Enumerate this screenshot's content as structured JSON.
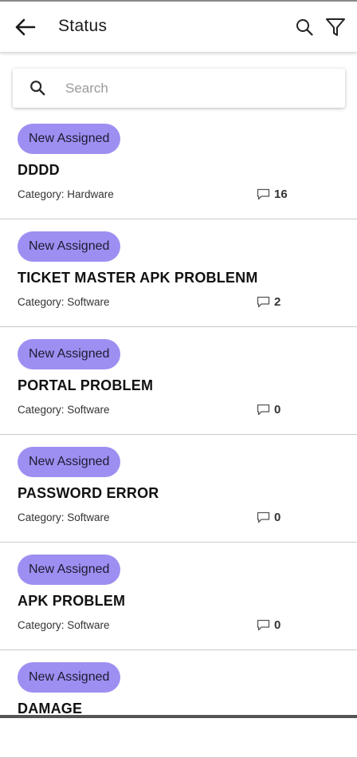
{
  "appbar": {
    "title": "Status",
    "back_icon": "arrow-left-icon",
    "search_icon": "search-icon",
    "filter_icon": "filter-icon"
  },
  "search": {
    "placeholder": "Search",
    "value": ""
  },
  "colors": {
    "badge_bg": "#9d8ff2",
    "divider": "#c9c9c9"
  },
  "tickets": [
    {
      "status": "New Assigned",
      "title": "DDDD",
      "category": "Category: Hardware",
      "comments": "16"
    },
    {
      "status": "New Assigned",
      "title": "TICKET MASTER APK PROBLENM",
      "category": "Category: Software",
      "comments": "2"
    },
    {
      "status": "New Assigned",
      "title": "PORTAL PROBLEM",
      "category": "Category: Software",
      "comments": "0"
    },
    {
      "status": "New Assigned",
      "title": "PASSWORD ERROR",
      "category": "Category: Software",
      "comments": "0"
    },
    {
      "status": "New Assigned",
      "title": "APK PROBLEM",
      "category": "Category: Software",
      "comments": "0"
    },
    {
      "status": "New Assigned",
      "title": "DAMAGE",
      "category": "",
      "comments": ""
    }
  ]
}
